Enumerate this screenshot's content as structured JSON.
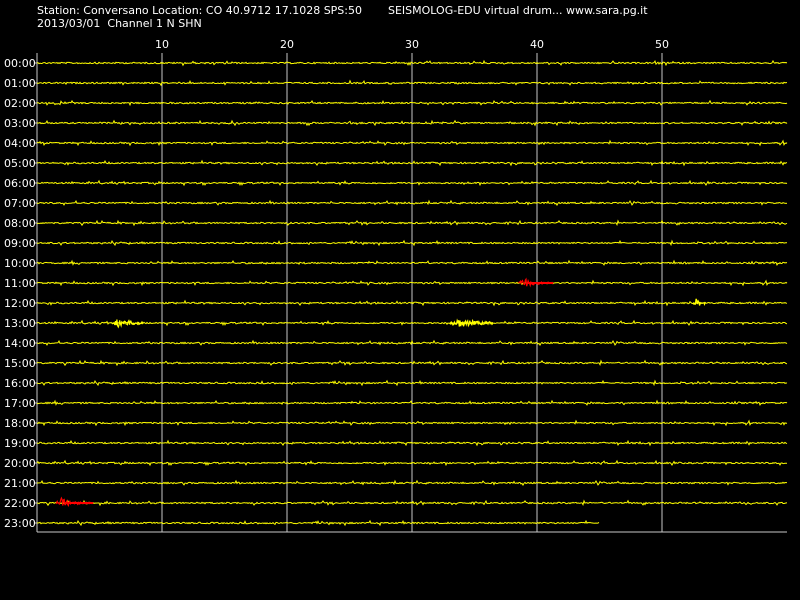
{
  "header": {
    "station_line": "Station: Conversano Location: CO 40.9712 17.1028 SPS:50",
    "date_line": "2013/03/01  Channel 1 N SHN",
    "title": "SEISMOLOG-EDU virtual drum... www.sara.pg.it"
  },
  "colors": {
    "background": "#000000",
    "trace": "#ffff00",
    "event": "#ff0000",
    "grid": "#c8c8c8",
    "text": "#ffffff"
  },
  "chart_data": {
    "type": "line",
    "x_unit": "minute",
    "xlim": [
      0,
      60
    ],
    "x_ticks": [
      10,
      20,
      30,
      40,
      50
    ],
    "grid": true,
    "rows": [
      "00:00",
      "01:00",
      "02:00",
      "03:00",
      "04:00",
      "05:00",
      "06:00",
      "07:00",
      "08:00",
      "09:00",
      "10:00",
      "11:00",
      "12:00",
      "13:00",
      "14:00",
      "15:00",
      "16:00",
      "17:00",
      "18:00",
      "19:00",
      "20:00",
      "21:00",
      "22:00",
      "23:00"
    ],
    "last_row_end_minute": 45,
    "events": [
      {
        "row": "11:00",
        "start_minute": 38.5,
        "end_minute": 41.3,
        "color": "red"
      },
      {
        "row": "13:00",
        "start_minute": 6.0,
        "end_minute": 8.5,
        "color": "yellow"
      },
      {
        "row": "13:00",
        "start_minute": 33.0,
        "end_minute": 36.5,
        "color": "yellow"
      },
      {
        "row": "12:00",
        "start_minute": 52.5,
        "end_minute": 53.5,
        "color": "yellow"
      },
      {
        "row": "22:00",
        "start_minute": 1.5,
        "end_minute": 4.5,
        "color": "red"
      }
    ]
  }
}
